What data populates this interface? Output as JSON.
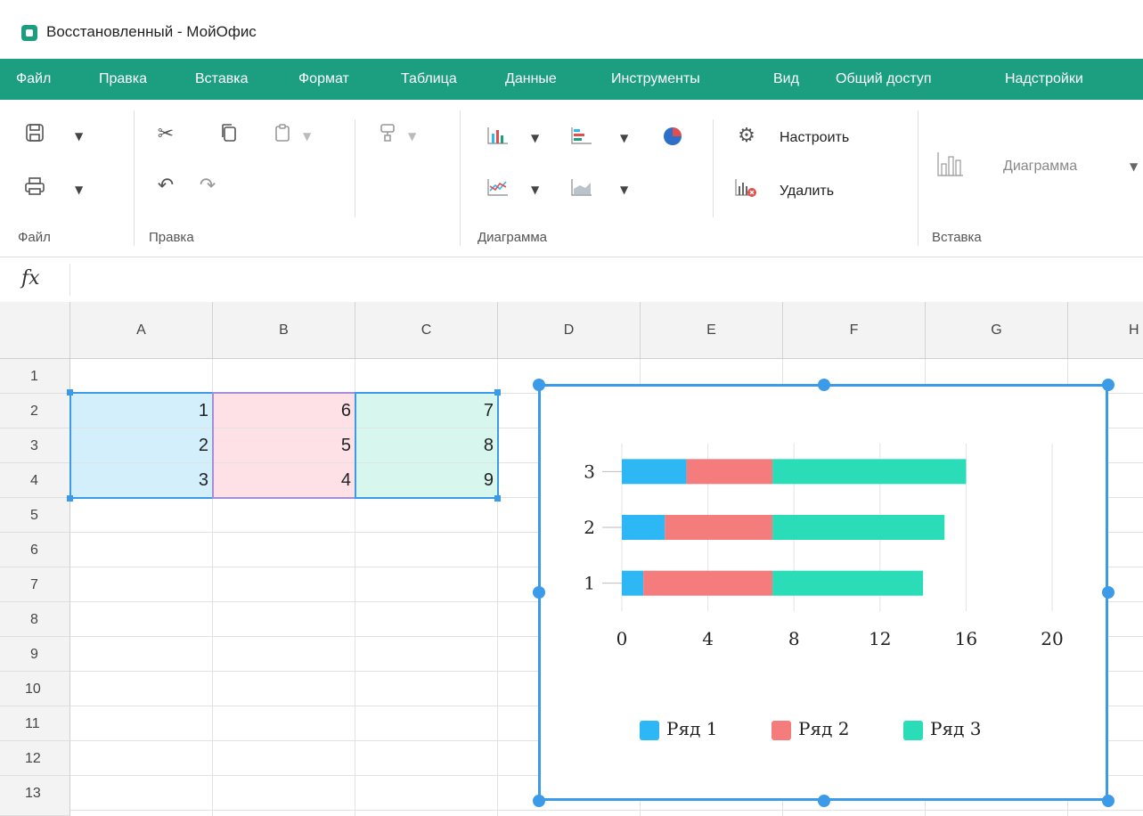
{
  "window": {
    "title": "Восстановленный - МойОфис"
  },
  "menu": [
    "Файл",
    "Правка",
    "Вставка",
    "Формат",
    "Таблица",
    "Данные",
    "Инструменты",
    "Вид",
    "Общий доступ",
    "Надстройки"
  ],
  "ribbon": {
    "groups": {
      "file": "Файл",
      "edit": "Правка",
      "chart": "Диаграмма",
      "insert": "Вставка"
    },
    "configure_label": "Настроить",
    "delete_label": "Удалить",
    "insert_chart_label": "Диаграмма"
  },
  "formula_bar": {
    "fx_label": "fx",
    "value": ""
  },
  "sheet": {
    "columns": [
      "A",
      "B",
      "C",
      "D",
      "E",
      "F",
      "G",
      "H"
    ],
    "rows": [
      "1",
      "2",
      "3",
      "4",
      "5",
      "6",
      "7",
      "8",
      "9",
      "10",
      "11",
      "12",
      "13"
    ],
    "cells": {
      "A2": "1",
      "B2": "6",
      "C2": "7",
      "A3": "2",
      "B3": "5",
      "C3": "8",
      "A4": "3",
      "B4": "4",
      "C4": "9"
    },
    "selection_colors": {
      "A": "#d4effc",
      "B": "#fde1e6",
      "C": "#d6f6ee"
    }
  },
  "chart_data": {
    "type": "bar",
    "orientation": "horizontal",
    "stacked": true,
    "categories": [
      "1",
      "2",
      "3"
    ],
    "series": [
      {
        "name": "Ряд 1",
        "values": [
          1,
          2,
          3
        ],
        "color": "#2db7f5"
      },
      {
        "name": "Ряд 2",
        "values": [
          6,
          5,
          4
        ],
        "color": "#f57c7c"
      },
      {
        "name": "Ряд 3",
        "values": [
          7,
          8,
          9
        ],
        "color": "#2bdcb9"
      }
    ],
    "x_ticks": [
      "0",
      "4",
      "8",
      "12",
      "16",
      "20"
    ],
    "xlim": [
      0,
      20
    ],
    "grid": true,
    "legend_position": "bottom"
  },
  "colors": {
    "accent": "#1b9f80",
    "selection": "#3c9be8"
  }
}
